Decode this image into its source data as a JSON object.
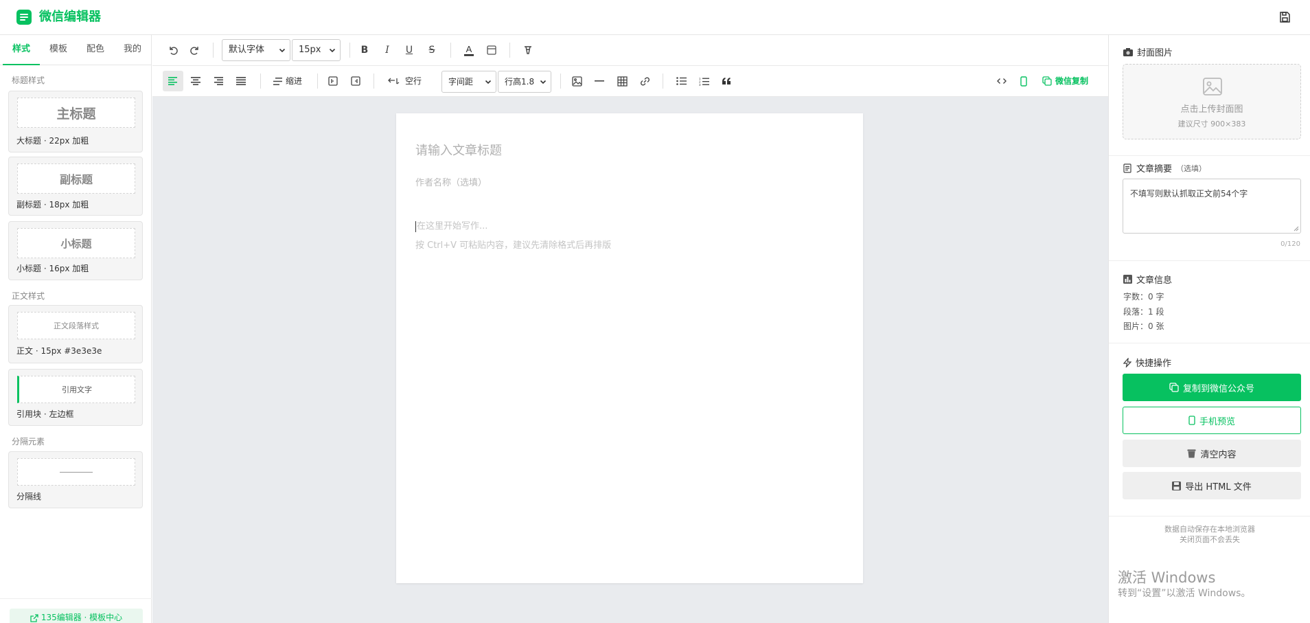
{
  "header": {
    "title": "微信编辑器"
  },
  "sidebar": {
    "tabs": [
      "样式",
      "模板",
      "配色",
      "我的"
    ],
    "section_titles": {
      "heading": "标题样式",
      "body": "正文样式",
      "divider": "分隔元素"
    },
    "cards": {
      "h1": {
        "preview": "主标题",
        "label": "大标题 · 22px 加粗"
      },
      "h2": {
        "preview": "副标题",
        "label": "副标题 · 18px 加粗"
      },
      "h3": {
        "preview": "小标题",
        "label": "小标题 · 16px 加粗"
      },
      "body": {
        "preview": "正文段落样式",
        "label": "正文 · 15px #3e3e3e"
      },
      "quote": {
        "preview": "引用文字",
        "label": "引用块 · 左边框"
      },
      "hr": {
        "label": "分隔线"
      }
    },
    "footer_link": "135编辑器 · 模板中心"
  },
  "toolbar": {
    "font_family": "默认字体",
    "font_size": "15px",
    "indent_label": "缩进",
    "blank_line_label": "空行",
    "letter_spacing": "字间距",
    "line_height": "行高1.8",
    "wechat_copy_label": "微信复制"
  },
  "editor": {
    "title_placeholder": "请输入文章标题",
    "author_placeholder": "作者名称（选填）",
    "body_placeholder": "在这里开始写作...",
    "body_hint": "按 Ctrl+V 可粘贴内容，建议先清除格式后再排版"
  },
  "right_panel": {
    "cover": {
      "title": "封面图片",
      "upload_text": "点击上传封面图",
      "size_hint": "建议尺寸 900×383"
    },
    "summary": {
      "title": "文章摘要",
      "optional": "（选填）",
      "placeholder": "不填写则默认抓取正文前54个字",
      "counter": "0/120"
    },
    "info": {
      "title": "文章信息",
      "words": "字数：0 字",
      "paragraphs": "段落：1 段",
      "images": "图片：0 张"
    },
    "quick": {
      "title": "快捷操作",
      "copy": "复制到微信公众号",
      "preview": "手机预览",
      "clear": "清空内容",
      "export": "导出 HTML 文件"
    },
    "autosave_line1": "数据自动保存在本地浏览器",
    "autosave_line2": "关闭页面不会丢失"
  },
  "watermark": {
    "line1": "激活 Windows",
    "line2": "转到“设置”以激活 Windows。"
  },
  "colors": {
    "accent": "#07c160",
    "canvas_bg": "#e9ebee"
  }
}
